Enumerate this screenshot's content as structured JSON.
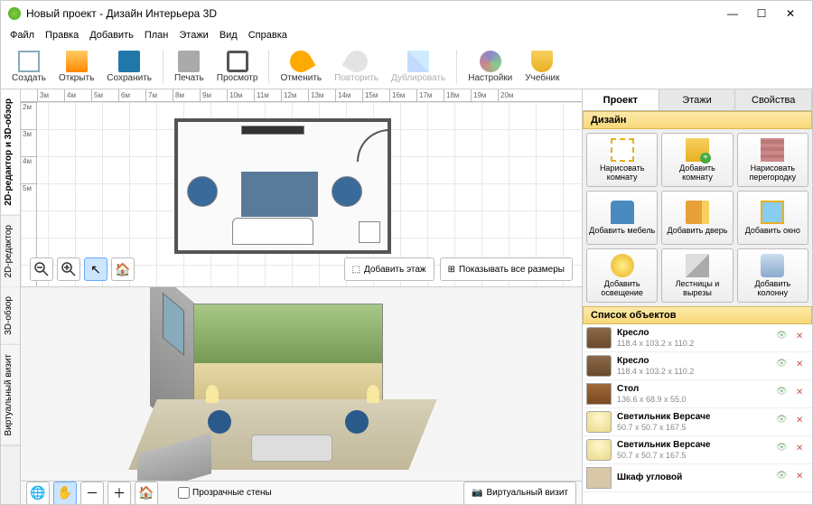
{
  "title": "Новый проект - Дизайн Интерьера 3D",
  "menu": [
    "Файл",
    "Правка",
    "Добавить",
    "План",
    "Этажи",
    "Вид",
    "Справка"
  ],
  "toolbar": {
    "create": "Создать",
    "open": "Открыть",
    "save": "Сохранить",
    "print": "Печать",
    "preview": "Просмотр",
    "undo": "Отменить",
    "redo": "Повторить",
    "duplicate": "Дублировать",
    "settings": "Настройки",
    "tutorial": "Учебник"
  },
  "vtabs": {
    "combo": "2D-редактор и 3D-обзор",
    "editor2d": "2D-редактор",
    "view3d": "3D-обзор",
    "virtual": "Виртуальный визит"
  },
  "ruler_h": [
    "3м",
    "4м",
    "5м",
    "6м",
    "7м",
    "8м",
    "9м",
    "10м",
    "11м",
    "12м",
    "13м",
    "14м",
    "15м",
    "16м",
    "17м",
    "18м",
    "19м",
    "20м"
  ],
  "ruler_v": [
    "2м",
    "3м",
    "4м",
    "5м"
  ],
  "canvas": {
    "add_floor": "Добавить этаж",
    "show_all_sizes": "Показывать все размеры",
    "transparent_walls": "Прозрачные стены",
    "virtual_visit": "Виртуальный визит"
  },
  "rtabs": {
    "project": "Проект",
    "floors": "Этажи",
    "properties": "Свойства"
  },
  "sections": {
    "design": "Дизайн",
    "objects": "Список объектов"
  },
  "grid": {
    "draw_room": "Нарисовать комнату",
    "add_room": "Добавить комнату",
    "draw_wall": "Нарисовать перегородку",
    "add_furniture": "Добавить мебель",
    "add_door": "Добавить дверь",
    "add_window": "Добавить окно",
    "add_light": "Добавить освещение",
    "stairs": "Лестницы и вырезы",
    "add_column": "Добавить колонну"
  },
  "objects": [
    {
      "name": "Кресло",
      "dims": "118.4 x 103.2 x 110.2",
      "kind": "chair"
    },
    {
      "name": "Кресло",
      "dims": "118.4 x 103.2 x 110.2",
      "kind": "chair"
    },
    {
      "name": "Стол",
      "dims": "136.6 x 68.9 x 55.0",
      "kind": "table"
    },
    {
      "name": "Светильник Версаче",
      "dims": "50.7 x 50.7 x 167.5",
      "kind": "lamp"
    },
    {
      "name": "Светильник Версаче",
      "dims": "50.7 x 50.7 x 167.5",
      "kind": "lamp"
    },
    {
      "name": "Шкаф угловой",
      "dims": "",
      "kind": "cabinet"
    }
  ]
}
